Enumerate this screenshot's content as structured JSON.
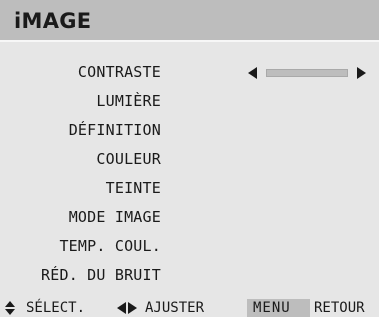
{
  "title": "iMAGE",
  "items": [
    {
      "label": "CONTRASTE"
    },
    {
      "label": "LUMIÈRE"
    },
    {
      "label": "DÉFINITION"
    },
    {
      "label": "COULEUR"
    },
    {
      "label": "TEINTE"
    },
    {
      "label": "MODE IMAGE"
    },
    {
      "label": "TEMP. COUL."
    },
    {
      "label": "RÉD. DU BRUIT"
    }
  ],
  "contrast_slider": {
    "level": 0.5,
    "icons": [
      "arrow-left-icon",
      "arrow-right-icon"
    ]
  },
  "footer": {
    "select_label": "SÉLECT.",
    "adjust_label": "AJUSTER",
    "menu_key": "MENU",
    "back_label": "RETOUR",
    "icons": [
      "up-down-icon",
      "left-right-icon"
    ]
  },
  "colors": {
    "background": "#e6e6e6",
    "title_bar": "#bdbdbd",
    "text": "#1a1a1a",
    "menu_key_bg": "#bdbdbd"
  }
}
